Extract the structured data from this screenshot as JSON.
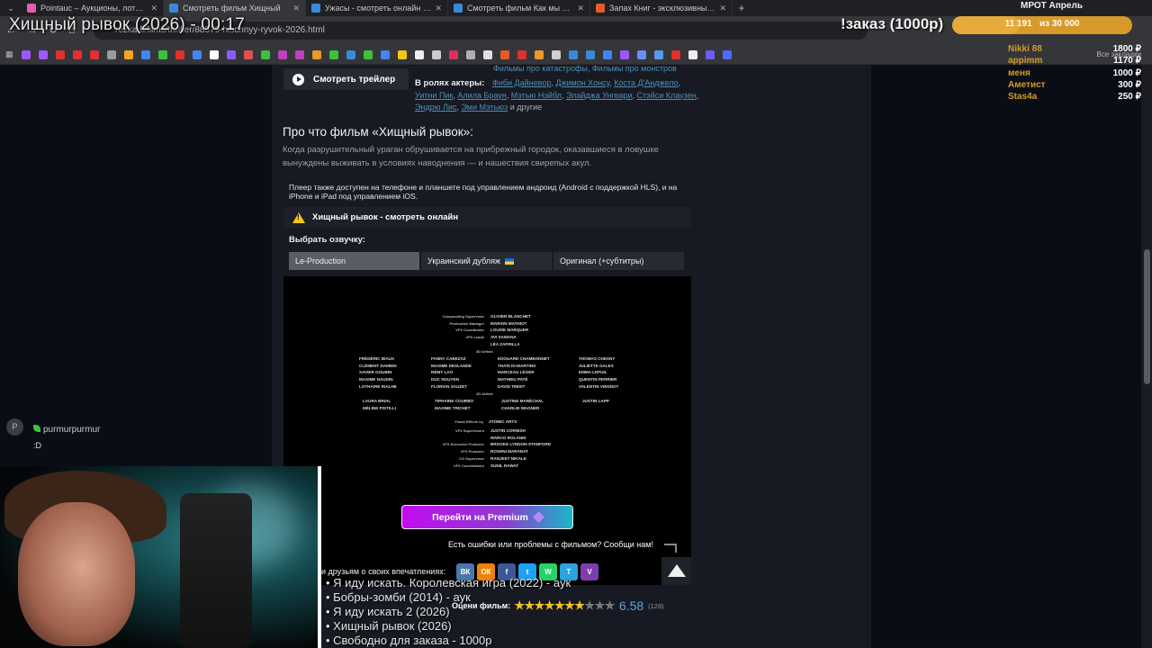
{
  "browser": {
    "tabs": [
      {
        "title": "Pointauc – Аукционы, лотере",
        "color": "#e05fb0"
      },
      {
        "title": "Смотреть фильм Хищный",
        "color": "#3a8ad8"
      },
      {
        "title": "Ужасы - смотреть онлайн бес",
        "color": "#3a8ad8"
      },
      {
        "title": "Смотреть фильм Как мы поко",
        "color": "#3a8ad8"
      },
      {
        "title": "Запах Книг - эксклюзивный к",
        "color": "#e65a2a"
      }
    ],
    "url": "rezka.fi/films/thriller/88579-hischnyy-ryvok-2026.html",
    "all_bookmarks": "Все закладки",
    "bookmark_colors": [
      "#9b59ff",
      "#9b59ff",
      "#e03030",
      "#e03030",
      "#e03030",
      "#9b9b9b",
      "#f5a623",
      "#4285f4",
      "#3fbf3f",
      "#e03030",
      "#4285f4",
      "#ffffff",
      "#8a5cff",
      "#e05050",
      "#3fbf3f",
      "#c040c0",
      "#c040c0",
      "#e89a2a",
      "#3fbf3f",
      "#3a8ad8",
      "#3fbf3f",
      "#4285f4",
      "#f5c518",
      "#eeeeee",
      "#cccccc",
      "#e03060",
      "#b0b0b0",
      "#e0e0e0",
      "#e65a2a",
      "#e03030",
      "#e89a2a",
      "#d0d0d0",
      "#3a8ad8",
      "#3a8ad8",
      "#4285f4",
      "#9b59ff",
      "#6a8cff",
      "#5a9ae8",
      "#e03030",
      "#eeeeee",
      "#6a5cff",
      "#4a6cff"
    ]
  },
  "stream": {
    "title": "Хищный рывок (2026) - 00:17",
    "chat_user": "purmurpurmur",
    "chat_message": ":D",
    "avatar_letter": "P",
    "queue": [
      "• Я иду искать. Королевская игра (2022) - аук",
      "• Бобры-зомби (2014) - аук",
      "• Я иду искать 2 (2026)",
      "• Хищный рывок (2026)",
      "• Свободно для заказа - 1000р"
    ],
    "order_label": "!заказ (1000р)",
    "goal_title": "МРОТ Апрель",
    "goal_current": "11 191",
    "goal_target": "из 30 000",
    "goal_fraction": 0.373,
    "donors": [
      {
        "name": "Nikki 88",
        "amount": "1800 ₽"
      },
      {
        "name": "appimm",
        "amount": "1170 ₽"
      },
      {
        "name": "меня",
        "amount": "1000 ₽"
      },
      {
        "name": "Аметист",
        "amount": "300 ₽"
      },
      {
        "name": "Stas4a",
        "amount": "250 ₽"
      }
    ]
  },
  "page": {
    "trailer_button": "Смотреть трейлер",
    "genres": "Фильмы про катастрофы, Фильмы про монстров",
    "actors_label": "В ролях актеры:",
    "actors": [
      "Фиби Дайневор",
      "Джимон Хонсу",
      "Коста Д'Анджело",
      "Уитни Пик",
      "Алила Браун",
      "Мэтью Нэйбл",
      "Элайджа Унгвари",
      "Стэйси Клаузен",
      "Эндрю Лис",
      "Эми Мэтьюз"
    ],
    "actors_tail": "и другие",
    "about_heading": "Про что фильм «Хищный рывок»:",
    "about_text": "Когда разрушительный ураган обрушивается на прибрежный городок, оказавшиеся в ловушке вынуждены выживать в условиях наводнения — и нашествия свирепых акул.",
    "player_note": "Плеер также доступен на телефоне и планшете под управлением андроид (Android с поддержкой HLS), и на iPhone и iPad под управлением iOS.",
    "watch_title": "Хищный рывок - смотреть онлайн",
    "dub_label": "Выбрать озвучку:",
    "dubs": [
      "Le-Production",
      "Украинский дубляж",
      "Оригинал (+субтитры)"
    ],
    "premium_button": "Перейти на Premium",
    "report_text": "Есть ошибки или проблемы с фильмом? Сообщи нам!",
    "share_label": "и друзьям о своих впечатлениях:",
    "share_buttons": [
      {
        "label": "ВК",
        "color": "#4a76a8"
      },
      {
        "label": "ОК",
        "color": "#ee8208"
      },
      {
        "label": "f",
        "color": "#3b5998"
      },
      {
        "label": "t",
        "color": "#1da1f2"
      },
      {
        "label": "W",
        "color": "#25d366"
      },
      {
        "label": "T",
        "color": "#2aa3de"
      },
      {
        "label": "V",
        "color": "#7d3daf"
      }
    ],
    "rating_label": "Оцени фильм:",
    "rating_value": "6.58",
    "rating_count": "(128)",
    "stars_on": 7,
    "stars_total": 10
  },
  "credits": {
    "rows": [
      {
        "role": "Compositing Supervisor",
        "name": "OLIVIER BLANCHET"
      },
      {
        "role": "Production Manager",
        "name": "MARION MATHIOT"
      },
      {
        "role": "VFX Coordinator",
        "name": "LOUISE MARQUER"
      },
      {
        "role": "VFX Leads",
        "name": "AVI SAMANA"
      },
      {
        "role": "",
        "name": "LÉA ZAFRILLA"
      }
    ],
    "section_3d": "3D Artists",
    "artists_3d": [
      [
        "FRÉDÉRIC BIAUX",
        "FANNY CABEZAZ",
        "EDOUARD CHAMBONNET",
        "THOMAS CHESNY"
      ],
      [
        "CLÉMENT DAMIEN",
        "MAXIME DESLANDE",
        "THAÏS DI-MARTINO",
        "JULIETTE GALES"
      ],
      [
        "XAVIER GOUBIN",
        "RÉMY LAO",
        "MARCEAU LÉGER",
        "EMMA LEPUIL"
      ],
      [
        "MAXIME NAUDIN",
        "DUC NGUYEN",
        "MATHIEU PATÉ",
        "QUENTIN PERRIER"
      ],
      [
        "LOTHAIRE RIALHE",
        "FLORIAN SAUZET",
        "DAVID TIMSIT",
        "VALENTIN VIENNOT"
      ]
    ],
    "section_2d": "2D Artists",
    "artists_2d": [
      [
        "LAURA BRIAL",
        "TIPHAINE COURBO",
        "JUSTINE MARÉCHAL",
        "JUSTIN LAPP"
      ],
      [
        "MÉLINE PISTILLI",
        "MAXIME TRICHET",
        "CHARLIE WAGNER",
        ""
      ]
    ],
    "vfx_by_label": "Visual Effects by",
    "vfx_by": "ATOMIC ARTS",
    "rows2": [
      {
        "role": "VFX Supervisors",
        "name": "JUSTIN CORNISH"
      },
      {
        "role": "",
        "name": "MARCO ROLANDI"
      },
      {
        "role": "VFX Executive Producer",
        "name": "BROOKE LYNDON-STANFORD"
      },
      {
        "role": "VFX Producer",
        "name": "ROSHNI MARANAT"
      },
      {
        "role": "CG Supervisor",
        "name": "RANJEET NIKALE"
      },
      {
        "role": "VFX Coordinators",
        "name": "SUNIL RAWAT"
      }
    ]
  }
}
